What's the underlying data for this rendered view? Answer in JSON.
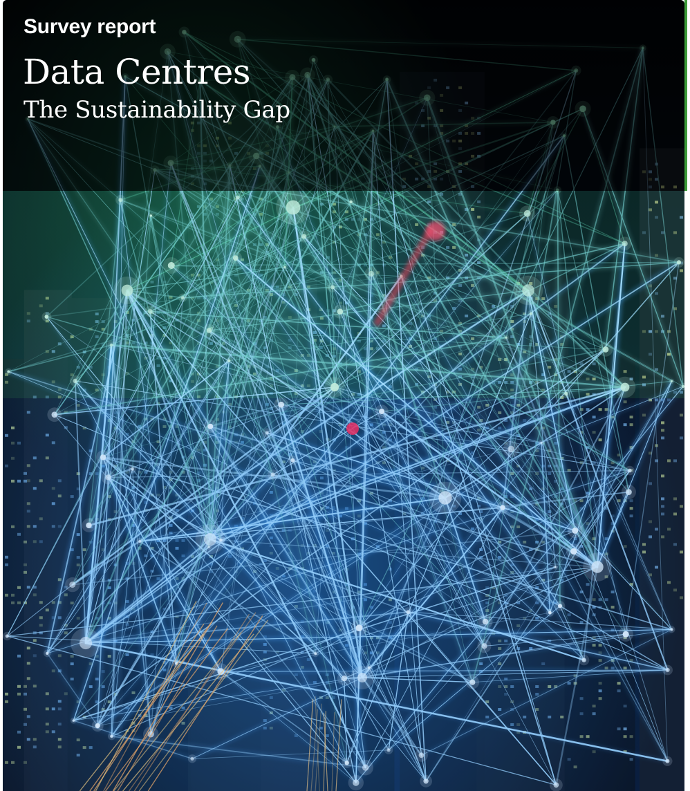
{
  "report": {
    "kicker": "Survey report",
    "title": "Data Centres",
    "subtitle": "The Sustainability Gap"
  },
  "cover_image": {
    "subject": "cover-photo",
    "colors": {
      "accent_green": "#3d9b3a",
      "night_sky": "#02050b",
      "light_blue": "#9fd8ff",
      "glow_white": "#e8f6ff",
      "teal": "#5fd6b0",
      "beacon_red": "#e8264a"
    }
  }
}
